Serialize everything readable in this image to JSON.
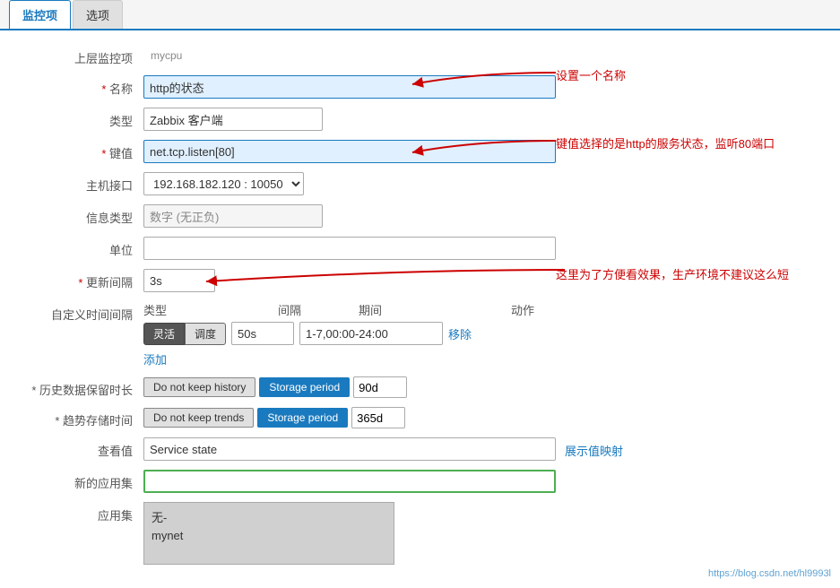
{
  "tabs": [
    {
      "id": "config",
      "label": "监控项",
      "active": true
    },
    {
      "id": "tags",
      "label": "选项",
      "active": false
    }
  ],
  "form": {
    "parent_label": "上层监控项",
    "parent_value": "mycpu",
    "name_label": "名称",
    "name_value": "http的状态",
    "type_label": "类型",
    "type_value": "Zabbix 客户端",
    "key_label": "键值",
    "key_value": "net.tcp.listen[80]",
    "interface_label": "主机接口",
    "interface_value": "192.168.182.120 : 10050",
    "info_type_label": "信息类型",
    "info_type_value": "数字 (无正负)",
    "unit_label": "单位",
    "unit_value": "",
    "update_label": "更新间隔",
    "update_value": "3s",
    "custom_interval_label": "自定义时间间隔",
    "custom_interval": {
      "headers": {
        "type": "类型",
        "gap": "间隔",
        "period": "期间",
        "action": "动作"
      },
      "rows": [
        {
          "type_btn1": "灵活",
          "type_btn2": "调度",
          "active": "btn1",
          "gap_value": "50s",
          "period_value": "1-7,00:00-24:00",
          "action": "移除"
        }
      ],
      "add_label": "添加"
    },
    "history_label": "* 历史数据保留时长",
    "history": {
      "btn_no_keep": "Do not keep history",
      "btn_storage": "Storage period",
      "active": "storage",
      "value": "90d"
    },
    "trend_label": "* 趋势存储时间",
    "trend": {
      "btn_no_keep": "Do not keep trends",
      "btn_storage": "Storage period",
      "active": "storage",
      "value": "365d"
    },
    "value_map_label": "查看值",
    "value_map_value": "Service state",
    "value_map_link": "展示值映射",
    "new_app_label": "新的应用集",
    "new_app_value": "",
    "app_label": "应用集",
    "app_items": [
      "无-",
      "mynet"
    ]
  },
  "annotations": {
    "name_annotation": "设置一个名称",
    "key_annotation": "键值选择的是http的服务状态，监听80端口",
    "update_annotation": "这里为了方便看效果，生产环境不建议这么短"
  },
  "watermark": "https://blog.csdn.net/hl9993l"
}
